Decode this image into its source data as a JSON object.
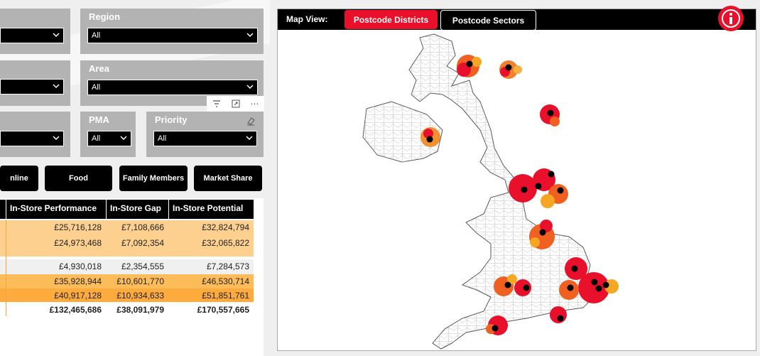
{
  "slicers": {
    "region": {
      "label": "Region",
      "value": "All"
    },
    "area": {
      "label": "Area",
      "value": "All"
    },
    "pma": {
      "label": "PMA",
      "value": "All"
    },
    "priority": {
      "label": "Priority",
      "value": "All"
    }
  },
  "buttons": {
    "online": "nline",
    "food": "Food",
    "family_members": "Family Members",
    "market_share": "Market Share"
  },
  "table": {
    "headers": [
      "In-Store Performance",
      "In-Store Gap",
      "In-Store Potential"
    ],
    "rows": [
      {
        "performance": "£25,716,128",
        "gap": "£7,108,666",
        "potential": "£32,824,794",
        "color": "#fdd090"
      },
      {
        "performance": "£24,973,468",
        "gap": "£7,092,354",
        "potential": "£32,065,822",
        "color": "#fdd090"
      },
      {
        "performance": "£4,930,018",
        "gap": "£2,354,555",
        "potential": "£7,284,573",
        "color": "#f0f0f0"
      },
      {
        "performance": "£35,928,944",
        "gap": "£10,601,770",
        "potential": "£46,530,714",
        "color": "#fdbc5a"
      },
      {
        "performance": "£40,917,128",
        "gap": "£10,934,633",
        "potential": "£51,851,761",
        "color": "#fdab3c"
      }
    ],
    "total": {
      "performance": "£132,465,686",
      "gap": "£38,091,979",
      "potential": "£170,557,665"
    }
  },
  "map": {
    "view_label": "Map View:",
    "tabs": [
      {
        "label": "Postcode Districts",
        "active": true
      },
      {
        "label": "Postcode Sectors",
        "active": false
      }
    ],
    "accent": "#e8102a"
  }
}
